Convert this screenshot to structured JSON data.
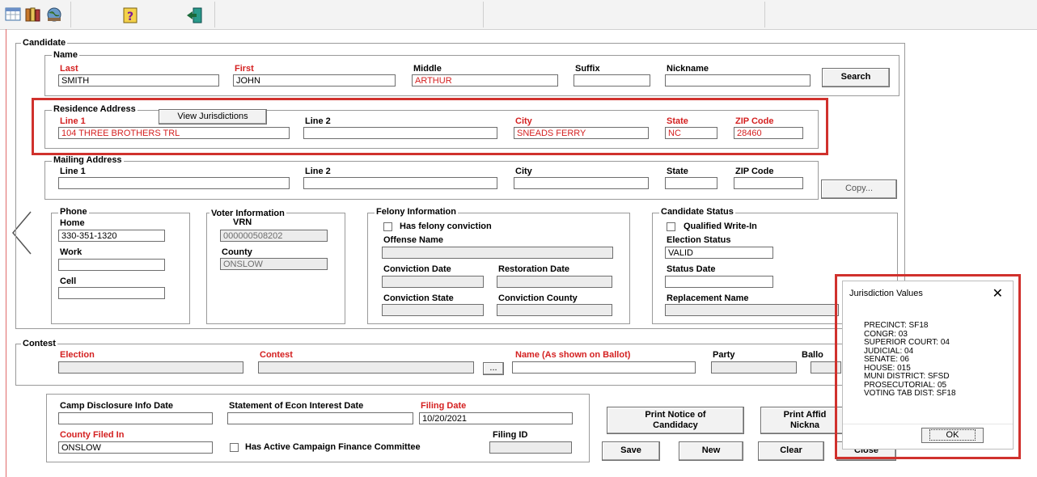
{
  "candidate": {
    "legend": "Candidate",
    "name": {
      "legend": "Name",
      "last": {
        "label": "Last",
        "value": "SMITH"
      },
      "first": {
        "label": "First",
        "value": "JOHN"
      },
      "middle": {
        "label": "Middle",
        "value": "ARTHUR"
      },
      "suffix": {
        "label": "Suffix",
        "value": ""
      },
      "nickname": {
        "label": "Nickname",
        "value": ""
      },
      "search_button": "Search"
    },
    "residence": {
      "legend": "Residence Address",
      "view_button": "View Jurisdictions",
      "line1": {
        "label": "Line 1",
        "value": "104 THREE BROTHERS TRL"
      },
      "line2": {
        "label": "Line 2",
        "value": ""
      },
      "city": {
        "label": "City",
        "value": "SNEADS FERRY"
      },
      "state": {
        "label": "State",
        "value": "NC"
      },
      "zip": {
        "label": "ZIP Code",
        "value": "28460"
      }
    },
    "mailing": {
      "legend": "Mailing Address",
      "line1": {
        "label": "Line 1",
        "value": ""
      },
      "line2": {
        "label": "Line 2",
        "value": ""
      },
      "city": {
        "label": "City",
        "value": ""
      },
      "state": {
        "label": "State",
        "value": ""
      },
      "zip": {
        "label": "ZIP Code",
        "value": ""
      },
      "copy_button": "Copy..."
    },
    "phone": {
      "legend": "Phone",
      "home": {
        "label": "Home",
        "value": "330-351-1320"
      },
      "work": {
        "label": "Work",
        "value": ""
      },
      "cell": {
        "label": "Cell",
        "value": ""
      }
    },
    "voter": {
      "legend": "Voter Information",
      "vrn": {
        "label": "VRN",
        "value": "000000508202"
      },
      "county": {
        "label": "County",
        "value": "ONSLOW"
      }
    },
    "felony": {
      "legend": "Felony Information",
      "has_conviction": "Has felony conviction",
      "offense": {
        "label": "Offense Name",
        "value": ""
      },
      "conviction_date": {
        "label": "Conviction Date",
        "value": ""
      },
      "restoration_date": {
        "label": "Restoration Date",
        "value": ""
      },
      "conviction_state": {
        "label": "Conviction State",
        "value": ""
      },
      "conviction_county": {
        "label": "Conviction County",
        "value": ""
      }
    },
    "status": {
      "legend": "Candidate Status",
      "qualified": "Qualified Write-In",
      "election_status": {
        "label": "Election Status",
        "value": "VALID"
      },
      "status_date": {
        "label": "Status Date",
        "value": ""
      },
      "replacement": {
        "label": "Replacement Name",
        "value": ""
      }
    }
  },
  "contest": {
    "legend": "Contest",
    "election": {
      "label": "Election",
      "value": ""
    },
    "contest": {
      "label": "Contest",
      "value": ""
    },
    "ellipsis": "...",
    "ballot_name": {
      "label": "Name (As shown on Ballot)",
      "value": ""
    },
    "party": {
      "label": "Party",
      "value": ""
    },
    "ballot_partial": {
      "label": "Ballo",
      "value": ""
    }
  },
  "filing": {
    "camp_disclosure": {
      "label": "Camp Disclosure Info Date",
      "value": ""
    },
    "econ_interest": {
      "label": "Statement of Econ Interest Date",
      "value": ""
    },
    "filing_date": {
      "label": "Filing Date",
      "value": "10/20/2021"
    },
    "county_filed": {
      "label": "County Filed In",
      "value": "ONSLOW"
    },
    "finance_committee": "Has Active Campaign Finance Committee",
    "filing_id": {
      "label": "Filing ID",
      "value": ""
    }
  },
  "actions": {
    "print_notice_l1": "Print Notice of",
    "print_notice_l2": "Candidacy",
    "print_affidavit_l1": "Print Affid",
    "print_affidavit_l2": "Nickna",
    "save": "Save",
    "new": "New",
    "clear": "Clear",
    "close": "Close"
  },
  "popup": {
    "title": "Jurisdiction Values",
    "lines": [
      "PRECINCT: SF18",
      "CONGR: 03",
      "SUPERIOR COURT: 04",
      "JUDICIAL: 04",
      "SENATE: 06",
      "HOUSE: 015",
      "MUNI DISTRICT: SFSD",
      "PROSECUTORIAL: 05",
      "VOTING TAB DIST: SF18"
    ],
    "ok": "OK"
  },
  "nav": {
    "back_glyph": "<"
  },
  "colors": {
    "required_label": "#d42020",
    "highlight_box": "#d0312d"
  }
}
